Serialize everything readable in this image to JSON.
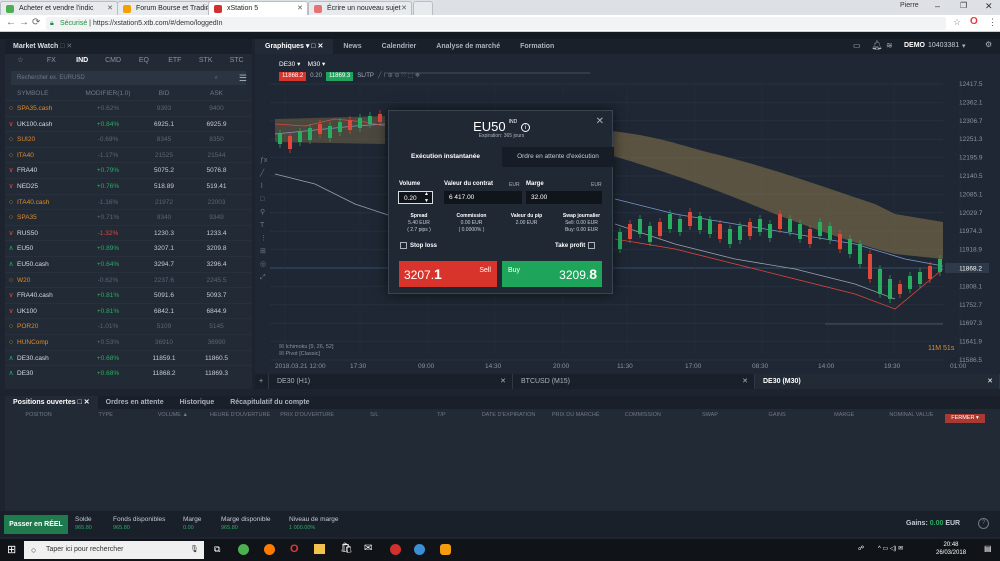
{
  "browser": {
    "tabs": [
      {
        "label": "Acheter et vendre l'indic",
        "color": "#4caf50"
      },
      {
        "label": "Forum Bourse et Trading",
        "color": "#f4a100"
      },
      {
        "label": "xStation 5",
        "color": "#d32f2f"
      },
      {
        "label": "Écrire un nouveau sujet",
        "color": "#e57373"
      }
    ],
    "secure_label": "Sécurisé",
    "url": "https://xstation5.xtb.com/#/demo/loggedIn",
    "user": "Pierre"
  },
  "market_watch": {
    "title": "Market Watch",
    "categories": [
      "☆",
      "FX",
      "IND",
      "CMD",
      "EQ",
      "ETF",
      "STK",
      "STC"
    ],
    "active_category": "IND",
    "search_placeholder": "Rechercher ex. EURUSD",
    "columns": [
      "SYMBOLE",
      "MODIFIER(1.0)",
      "BID",
      "ASK"
    ],
    "rows": [
      {
        "dir": "○",
        "sym": "SPA35.cash",
        "chg": "+0.62%",
        "bid": "9393",
        "ask": "9400",
        "state": "closed"
      },
      {
        "dir": "∨",
        "sym": "UK100.cash",
        "chg": "+0.84%",
        "bid": "6925.1",
        "ask": "6925.9",
        "state": "down"
      },
      {
        "dir": "○",
        "sym": "SUI20",
        "chg": "-0.69%",
        "bid": "8345",
        "ask": "8350",
        "state": "closed"
      },
      {
        "dir": "○",
        "sym": "ITA40",
        "chg": "-1.17%",
        "bid": "21525",
        "ask": "21544",
        "state": "closed"
      },
      {
        "dir": "∨",
        "sym": "FRA40",
        "chg": "+0.79%",
        "bid": "5075.2",
        "ask": "5076.8",
        "state": "down"
      },
      {
        "dir": "∨",
        "sym": "NED25",
        "chg": "+0.76%",
        "bid": "518.89",
        "ask": "519.41",
        "state": "down"
      },
      {
        "dir": "○",
        "sym": "ITA40.cash",
        "chg": "-1.16%",
        "bid": "21972",
        "ask": "22003",
        "state": "closed"
      },
      {
        "dir": "○",
        "sym": "SPA35",
        "chg": "+0.71%",
        "bid": "9340",
        "ask": "9349",
        "state": "closed"
      },
      {
        "dir": "∨",
        "sym": "RUS50",
        "chg": "-1.32%",
        "bid": "1230.3",
        "ask": "1233.4",
        "state": "down"
      },
      {
        "dir": "∧",
        "sym": "EU50",
        "chg": "+0.89%",
        "bid": "3207.1",
        "ask": "3209.8",
        "state": "up"
      },
      {
        "dir": "∧",
        "sym": "EU50.cash",
        "chg": "+0.64%",
        "bid": "3294.7",
        "ask": "3296.4",
        "state": "up"
      },
      {
        "dir": "○",
        "sym": "W20",
        "chg": "-0.62%",
        "bid": "2237.6",
        "ask": "2245.5",
        "state": "closed"
      },
      {
        "dir": "∨",
        "sym": "FRA40.cash",
        "chg": "+0.81%",
        "bid": "5091.6",
        "ask": "5093.7",
        "state": "down"
      },
      {
        "dir": "∨",
        "sym": "UK100",
        "chg": "+0.81%",
        "bid": "6842.1",
        "ask": "6844.9",
        "state": "down"
      },
      {
        "dir": "○",
        "sym": "POR20",
        "chg": "-1.01%",
        "bid": "5109",
        "ask": "5145",
        "state": "closed"
      },
      {
        "dir": "○",
        "sym": "HUNComp",
        "chg": "+0.53%",
        "bid": "36910",
        "ask": "36990",
        "state": "closed"
      },
      {
        "dir": "∧",
        "sym": "DE30.cash",
        "chg": "+0.68%",
        "bid": "11859.1",
        "ask": "11860.5",
        "state": "up"
      },
      {
        "dir": "∧",
        "sym": "DE30",
        "chg": "+0.68%",
        "bid": "11868.2",
        "ask": "11869.3",
        "state": "up"
      }
    ]
  },
  "chart_header": {
    "tabs": [
      "Graphiques",
      "News",
      "Calendrier",
      "Analyse de marché",
      "Formation"
    ],
    "account_mode": "DEMO",
    "account_id": "10403381"
  },
  "chart": {
    "symbol": "DE30",
    "timeframe": "M30",
    "sell_price": "11868.2",
    "volume": "0.20",
    "buy_price": "11869.3",
    "sltp": "SL/TP",
    "price_axis": [
      "12417.5",
      "12362.1",
      "12306.7",
      "12251.3",
      "12195.9",
      "12140.5",
      "12085.1",
      "12029.7",
      "11974.3",
      "11918.9",
      "11868.2",
      "11808.1",
      "11752.7",
      "11697.3",
      "11641.9",
      "11586.5"
    ],
    "current_price": "11868.2",
    "time_axis": [
      "2018.03.21 12:00",
      "17:30",
      "09:00",
      "14:30",
      "20:00",
      "11:30",
      "17:00",
      "08:30",
      "14:00",
      "19:30",
      "01:00"
    ],
    "indicators": [
      "Ichimoku [9, 26, 52]",
      "Pivot [Classic]"
    ],
    "countdown": "11M 51s"
  },
  "chart_tabs": [
    "DE30 (H1)",
    "BTCUSD (M15)",
    "DE30 (M30)"
  ],
  "modal": {
    "symbol": "EU50",
    "badge": "IND",
    "expiration": "Expiration: 365 jours",
    "tab_instant": "Exécution instantanée",
    "tab_pending": "Ordre en attente d'exécution",
    "volume_label": "Volume",
    "volume_value": "0.20",
    "contract_label": "Valeur du contrat",
    "contract_unit": "EUR",
    "contract_value": "6 417.00",
    "margin_label": "Marge",
    "margin_unit": "EUR",
    "margin_value": "32.00",
    "spread_label": "Spread",
    "spread_value": "5.40 EUR",
    "spread_pips": "( 2.7 pips )",
    "commission_label": "Commission",
    "commission_value": "0.00 EUR",
    "commission_pct": "( 0.0000% )",
    "pip_label": "Valeur du pip",
    "pip_value": "2.00 EUR",
    "swap_label": "Swap journalier",
    "swap_sell": "Sell: 0.00 EUR",
    "swap_buy": "Buy: 0.00 EUR",
    "stop_loss": "Stop loss",
    "take_profit": "Take profit",
    "sell_price_main": "3207.",
    "sell_price_big": "1",
    "sell_label": "Sell",
    "buy_label": "Buy",
    "buy_price_main": "3209.",
    "buy_price_big": "8"
  },
  "positions": {
    "tabs": [
      "Positions ouvertes",
      "Ordres en attente",
      "Historique",
      "Récapitulatif du compte"
    ],
    "columns": [
      "POSITION",
      "TYPE",
      "VOLUME ▲",
      "HEURE D'OUVERTURE",
      "PRIX D'OUVERTURE",
      "S/L",
      "T/P",
      "DATE D'EXPIRATION",
      "PRIX DU MARCHÉ",
      "COMMISSION",
      "SWAP",
      "GAINS",
      "MARGE",
      "NOMINAL VALUE"
    ],
    "close_label": "FERMER ▾"
  },
  "account": {
    "real_button": "Passer en RÉEL",
    "stats": [
      {
        "label": "Solde",
        "value": "965.80"
      },
      {
        "label": "Fonds disponibles",
        "value": "965.80"
      },
      {
        "label": "Marge",
        "value": "0.00"
      },
      {
        "label": "Marge disponible",
        "value": "965.80"
      },
      {
        "label": "Niveau de marge",
        "value": "1 000.00%"
      }
    ],
    "gains_label": "Gains:",
    "gains_value": "0.00",
    "gains_currency": "EUR"
  },
  "taskbar": {
    "search": "Taper ici pour rechercher",
    "time": "20:48",
    "date": "26/03/2018"
  },
  "colors": {
    "up": "#27ae60",
    "down": "#e0483a",
    "sell": "#d9342b",
    "buy": "#1fa45b",
    "cloud": "#8a7a55"
  }
}
